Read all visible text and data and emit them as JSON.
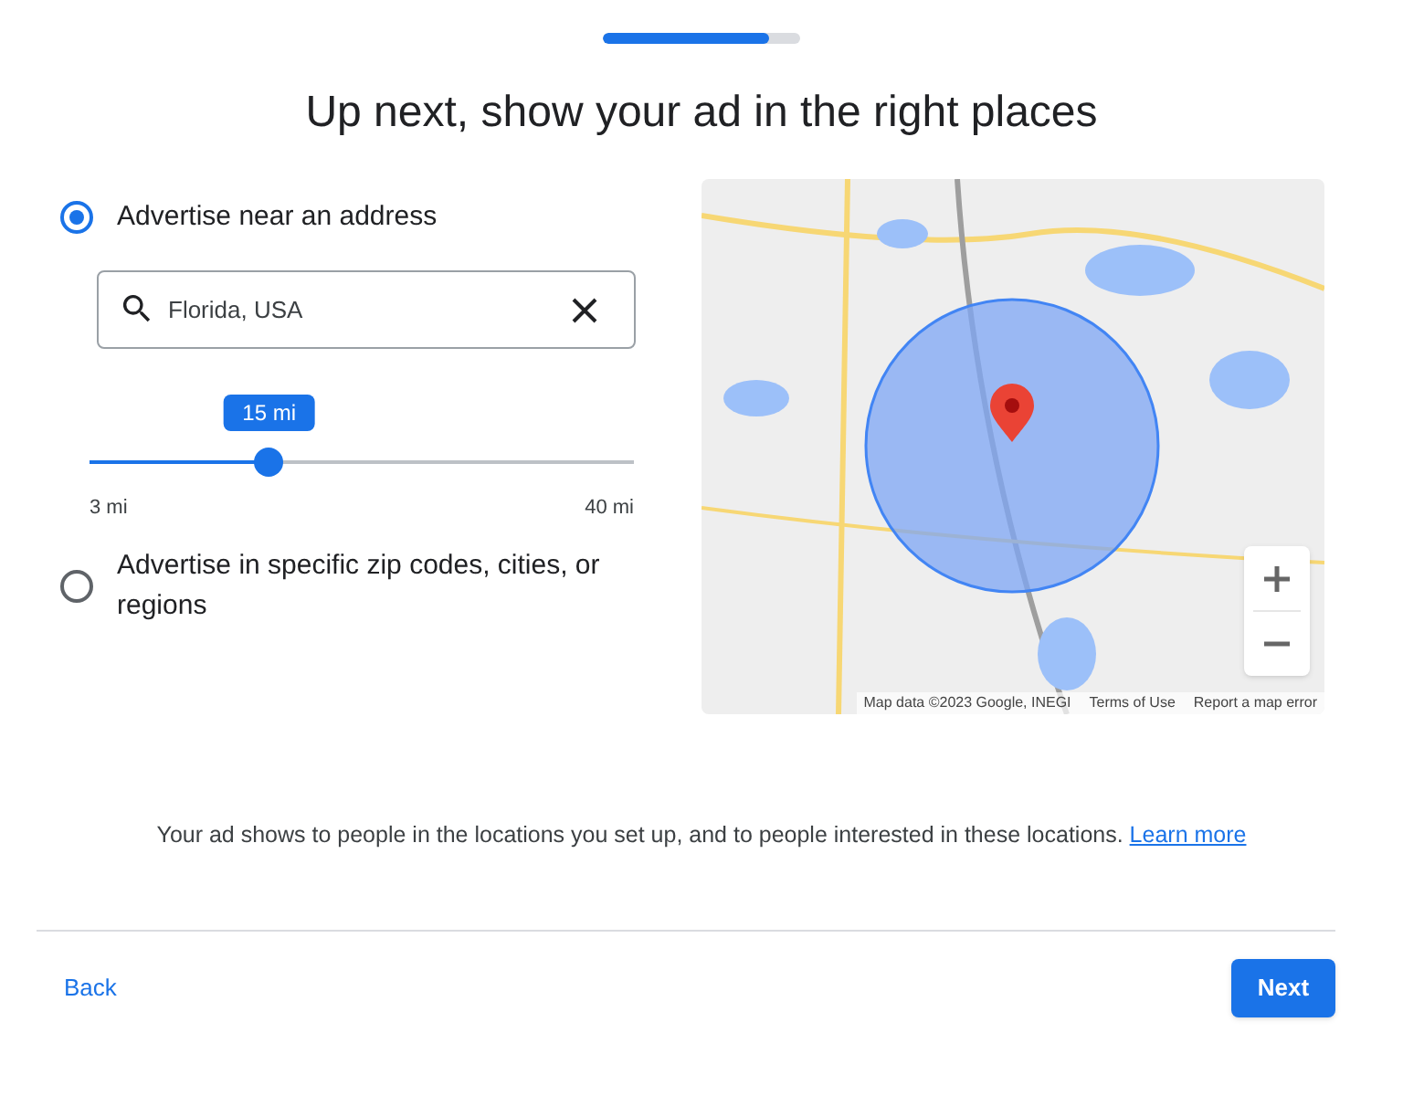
{
  "progress": {
    "level": 0.84
  },
  "title": "Up next, show your ad in the right places",
  "options": [
    {
      "kind": "address",
      "label": "Advertise near an address",
      "selected": true,
      "search": {
        "value": "Florida, USA"
      },
      "radius": {
        "level": 0.33,
        "reading": "15 mi",
        "min_label": "3 mi",
        "max_label": "40 mi"
      }
    },
    {
      "kind": "regions",
      "label": "Advertise in specific zip codes, cities, or regions",
      "selected": false
    }
  ],
  "map": {
    "kind": "picture",
    "attribution": [
      "Map data ©2023 Google, INEGI",
      "Terms of Use",
      "Report a map error"
    ]
  },
  "info": {
    "text": "Your ad shows to people in the locations you set up, and to people interested in these locations.",
    "link": "Learn more"
  },
  "footer": {
    "back": "Back",
    "next": "Next"
  }
}
